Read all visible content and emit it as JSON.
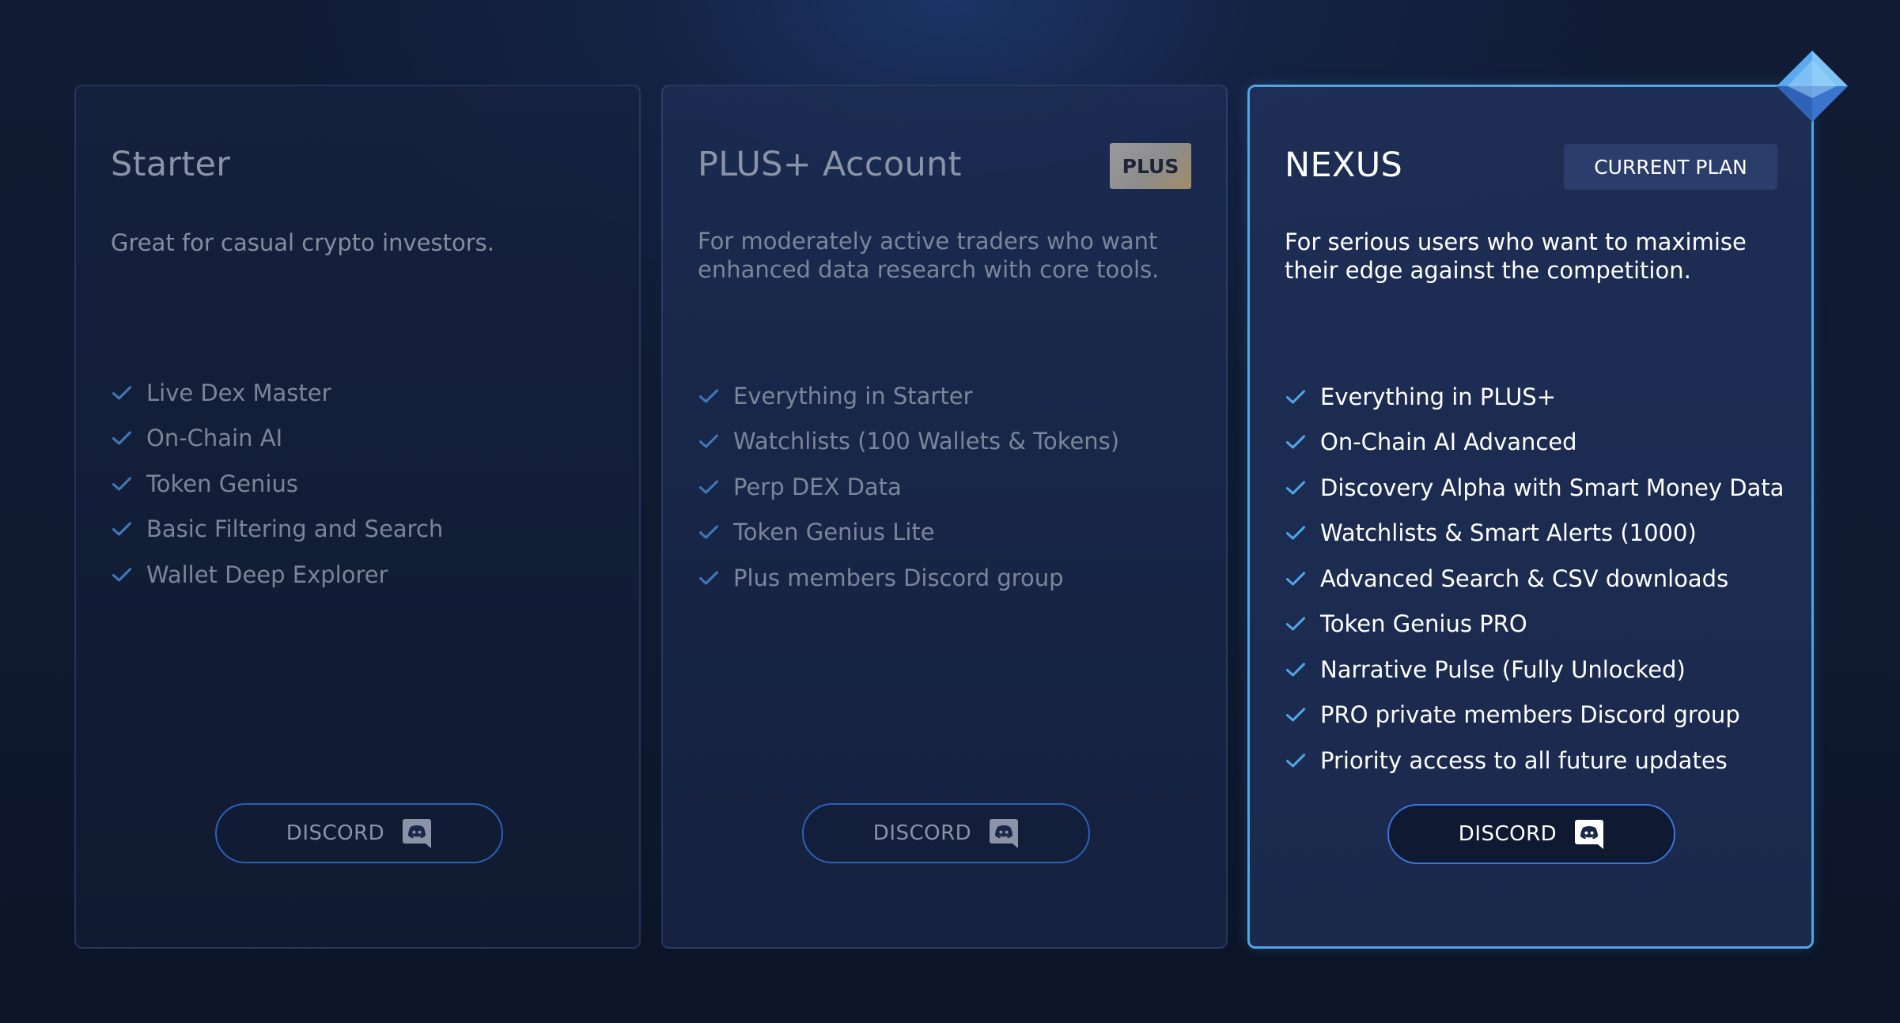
{
  "plans": [
    {
      "title": "Starter",
      "description": "Great for casual crypto investors.",
      "features": [
        "Live Dex Master",
        "On-Chain AI",
        "Token Genius",
        "Basic Filtering and Search",
        "Wallet Deep Explorer"
      ],
      "button_label": "DISCORD",
      "button_icon": "discord-icon"
    },
    {
      "title": "PLUS+ Account",
      "badge": "PLUS",
      "description": "For moderately active traders who want enhanced data research with core tools.",
      "features": [
        "Everything in Starter",
        "Watchlists (100 Wallets & Tokens)",
        "Perp DEX Data",
        "Token Genius Lite",
        "Plus members Discord group"
      ],
      "button_label": "DISCORD",
      "button_icon": "discord-icon"
    },
    {
      "title": "NEXUS",
      "badge": "CURRENT PLAN",
      "description": "For serious users who want to maximise their edge against the competition.",
      "features": [
        "Everything in PLUS+",
        "On-Chain AI Advanced",
        "Discovery Alpha with Smart Money Data",
        "Watchlists & Smart Alerts (1000)",
        "Advanced Search & CSV downloads",
        "Token Genius PRO",
        "Narrative Pulse (Fully Unlocked)",
        "PRO private members Discord group",
        "Priority access to all future updates"
      ],
      "button_label": "DISCORD",
      "button_icon": "discord-icon",
      "decoration_icon": "diamond-gem-icon"
    }
  ],
  "colors": {
    "background": "#111b33",
    "accent": "#4ea6e6",
    "check": "#4fa4e8",
    "button_border": "#2b61b8"
  }
}
